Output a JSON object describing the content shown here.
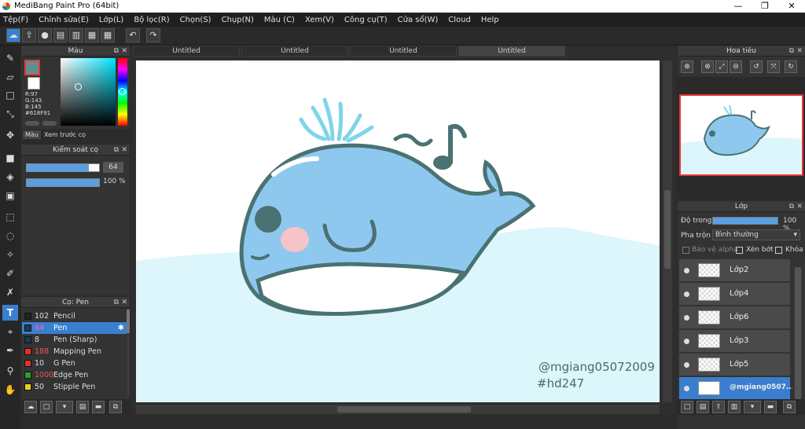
{
  "window": {
    "title": "MediBang Paint Pro (64bit)",
    "minimize": "—",
    "maximize": "❐",
    "close": "✕"
  },
  "menu": [
    "Tệp(F)",
    "Chỉnh sửa(E)",
    "Lớp(L)",
    "Bộ lọc(R)",
    "Chọn(S)",
    "Chụp(N)",
    "Màu (C)",
    "Xem(V)",
    "Công cụ(T)",
    "Cửa sổ(W)",
    "Cloud",
    "Help"
  ],
  "tabs": [
    "Untitled",
    "Untitled",
    "Untitled",
    "Untitled"
  ],
  "color_panel": {
    "title": "Màu",
    "r": "R:97",
    "g": "G:143",
    "b": "B:145",
    "hex": "#618F91",
    "tab_color": "Màu",
    "tab_preview": "Xem trước cọ",
    "current_color": "#618f91"
  },
  "brush_control": {
    "title": "Kiểm soát cọ",
    "size": "64",
    "opacity": "100 %",
    "size_fraction": 0.86,
    "opacity_fraction": 1.0
  },
  "brush_panel": {
    "title": "Cọ: Pen",
    "items": [
      {
        "size": "102",
        "name": "Pencil",
        "color": "#222222"
      },
      {
        "size": "64",
        "name": "Pen",
        "color": "#1a3a5a"
      },
      {
        "size": "8",
        "name": "Pen (Sharp)",
        "color": "#1a3a5a"
      },
      {
        "size": "188",
        "name": "Mapping Pen",
        "color": "#e03030"
      },
      {
        "size": "10",
        "name": "G Pen",
        "color": "#e03030"
      },
      {
        "size": "1000",
        "name": "Edge Pen",
        "color": "#2aa02a"
      },
      {
        "size": "50",
        "name": "Stipple Pen",
        "color": "#e8d020"
      }
    ]
  },
  "navigator": {
    "title": "Hoa tiêu"
  },
  "layer_panel": {
    "title": "Lớp",
    "opacity_label": "Độ trong",
    "opacity_value": "100 %",
    "blend_label": "Pha trộn",
    "blend_value": "Bình thường",
    "protect_alpha": "Bảo vệ alpha",
    "clipping": "Xén bớt",
    "lock": "Khóa",
    "layers": [
      "Lớp2",
      "Lớp4",
      "Lớp6",
      "Lớp3",
      "Lớp5",
      "@mgiang0507..."
    ]
  },
  "artwork": {
    "signature_line1": "@mgiang05072009",
    "signature_line2": "#hd247"
  },
  "colors": {
    "accent": "#3a7fcf",
    "whale": "#8fc8ef",
    "outline": "#4a7272",
    "water": "#dcf6fb"
  }
}
